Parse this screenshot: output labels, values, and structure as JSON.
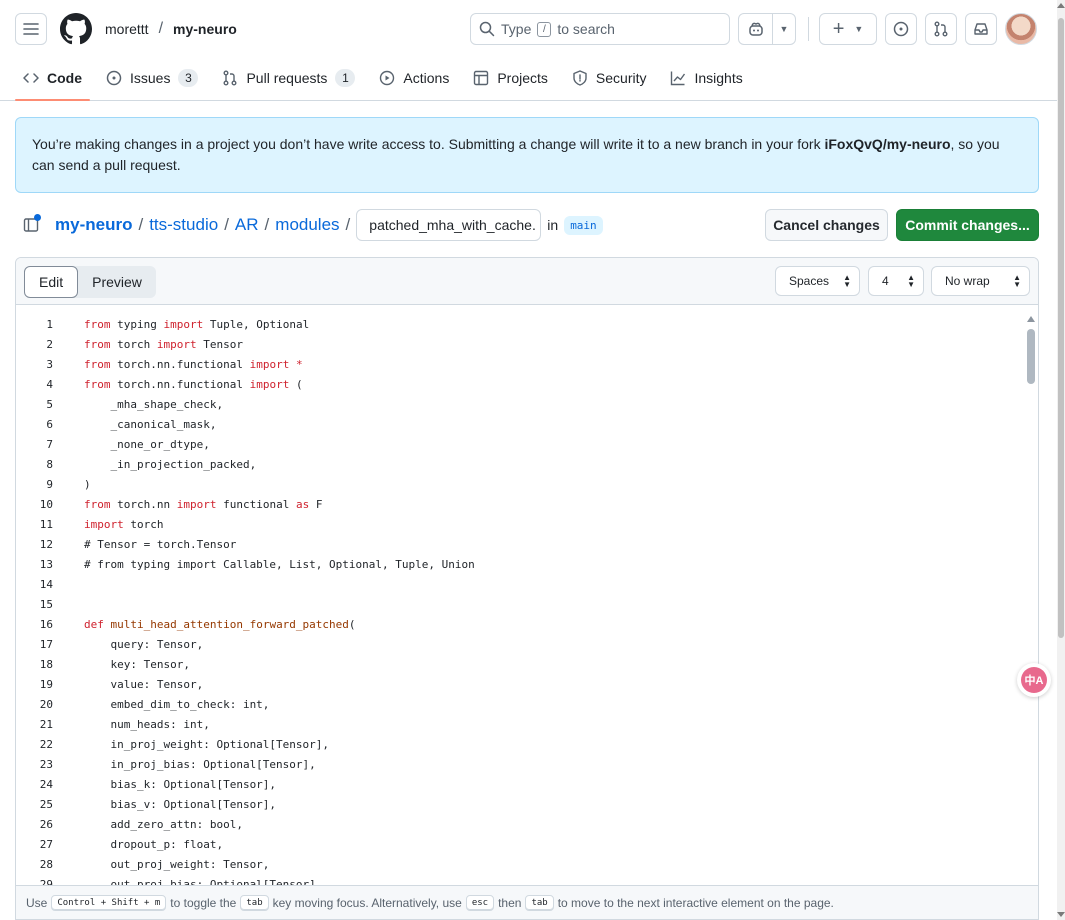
{
  "header": {
    "owner": "morettt",
    "separator": "/",
    "repo": "my-neuro",
    "search_prefix": "Type",
    "search_key": "/",
    "search_suffix": "to search"
  },
  "tabs": [
    {
      "label": "Code",
      "icon": "code-icon",
      "counter": ""
    },
    {
      "label": "Issues",
      "icon": "issue-icon",
      "counter": "3"
    },
    {
      "label": "Pull requests",
      "icon": "pull-request-icon",
      "counter": "1"
    },
    {
      "label": "Actions",
      "icon": "play-icon",
      "counter": ""
    },
    {
      "label": "Projects",
      "icon": "table-icon",
      "counter": ""
    },
    {
      "label": "Security",
      "icon": "shield-icon",
      "counter": ""
    },
    {
      "label": "Insights",
      "icon": "graph-icon",
      "counter": ""
    }
  ],
  "banner": {
    "text_before": "You’re making changes in a project you don’t have write access to. Submitting a change will write it to a new branch in your fork ",
    "fork": "iFoxQvQ/my-neuro",
    "text_after": ", so you can send a pull request."
  },
  "path": {
    "root": "my-neuro",
    "dir1": "tts-studio",
    "dir2": "AR",
    "dir3": "modules",
    "filename": "patched_mha_with_cache.",
    "in_label": "in",
    "branch": "main",
    "cancel_label": "Cancel changes",
    "commit_label": "Commit changes..."
  },
  "editor": {
    "edit_label": "Edit",
    "preview_label": "Preview",
    "indent_mode": "Spaces",
    "indent_size": "4",
    "wrap_mode": "No wrap"
  },
  "code_lines": [
    [
      [
        "kw",
        "from"
      ],
      [
        "t",
        " typing "
      ],
      [
        "kw",
        "import"
      ],
      [
        "t",
        " Tuple, Optional"
      ]
    ],
    [
      [
        "kw",
        "from"
      ],
      [
        "t",
        " torch "
      ],
      [
        "kw",
        "import"
      ],
      [
        "t",
        " Tensor"
      ]
    ],
    [
      [
        "kw",
        "from"
      ],
      [
        "t",
        " torch.nn.functional "
      ],
      [
        "kw",
        "import"
      ],
      [
        "t",
        " "
      ],
      [
        "kw",
        "*"
      ]
    ],
    [
      [
        "kw",
        "from"
      ],
      [
        "t",
        " torch.nn.functional "
      ],
      [
        "kw",
        "import"
      ],
      [
        "t",
        " ("
      ]
    ],
    [
      [
        "t",
        "    _mha_shape_check,"
      ]
    ],
    [
      [
        "t",
        "    _canonical_mask,"
      ]
    ],
    [
      [
        "t",
        "    _none_or_dtype,"
      ]
    ],
    [
      [
        "t",
        "    _in_projection_packed,"
      ]
    ],
    [
      [
        "t",
        ")"
      ]
    ],
    [
      [
        "kw",
        "from"
      ],
      [
        "t",
        " torch.nn "
      ],
      [
        "kw",
        "import"
      ],
      [
        "t",
        " functional "
      ],
      [
        "kw",
        "as"
      ],
      [
        "t",
        " F"
      ]
    ],
    [
      [
        "kw",
        "import"
      ],
      [
        "t",
        " torch"
      ]
    ],
    [
      [
        "t",
        "# Tensor = torch.Tensor"
      ]
    ],
    [
      [
        "t",
        "# from typing import Callable, List, Optional, Tuple, Union"
      ]
    ],
    [],
    [],
    [
      [
        "kw",
        "def"
      ],
      [
        "t",
        " "
      ],
      [
        "fn",
        "multi_head_attention_forward_patched"
      ],
      [
        "t",
        "("
      ]
    ],
    [
      [
        "t",
        "    query: Tensor,"
      ]
    ],
    [
      [
        "t",
        "    key: Tensor,"
      ]
    ],
    [
      [
        "t",
        "    value: Tensor,"
      ]
    ],
    [
      [
        "t",
        "    embed_dim_to_check: int,"
      ]
    ],
    [
      [
        "t",
        "    num_heads: int,"
      ]
    ],
    [
      [
        "t",
        "    in_proj_weight: Optional[Tensor],"
      ]
    ],
    [
      [
        "t",
        "    in_proj_bias: Optional[Tensor],"
      ]
    ],
    [
      [
        "t",
        "    bias_k: Optional[Tensor],"
      ]
    ],
    [
      [
        "t",
        "    bias_v: Optional[Tensor],"
      ]
    ],
    [
      [
        "t",
        "    add_zero_attn: bool,"
      ]
    ],
    [
      [
        "t",
        "    dropout_p: float,"
      ]
    ],
    [
      [
        "t",
        "    out_proj_weight: Tensor,"
      ]
    ],
    [
      [
        "t",
        "    out_proj_bias: Optional[Tensor],"
      ]
    ]
  ],
  "footer": {
    "use": "Use",
    "keys1": "Control + Shift + m",
    "mid1": "to toggle the",
    "key_tab": "tab",
    "mid2": "key moving focus. Alternatively, use",
    "key_esc": "esc",
    "then": "then",
    "key_tab2": "tab",
    "end": "to move to the next interactive element on the page."
  },
  "translate_fab_label": "中A",
  "colors": {
    "accent_blue": "#0969da",
    "commit_green": "#1f883d",
    "keyword_red": "#cf222e",
    "function_brown": "#953800",
    "tab_underline": "#fd8c73",
    "banner_bg": "#ddf4ff"
  }
}
